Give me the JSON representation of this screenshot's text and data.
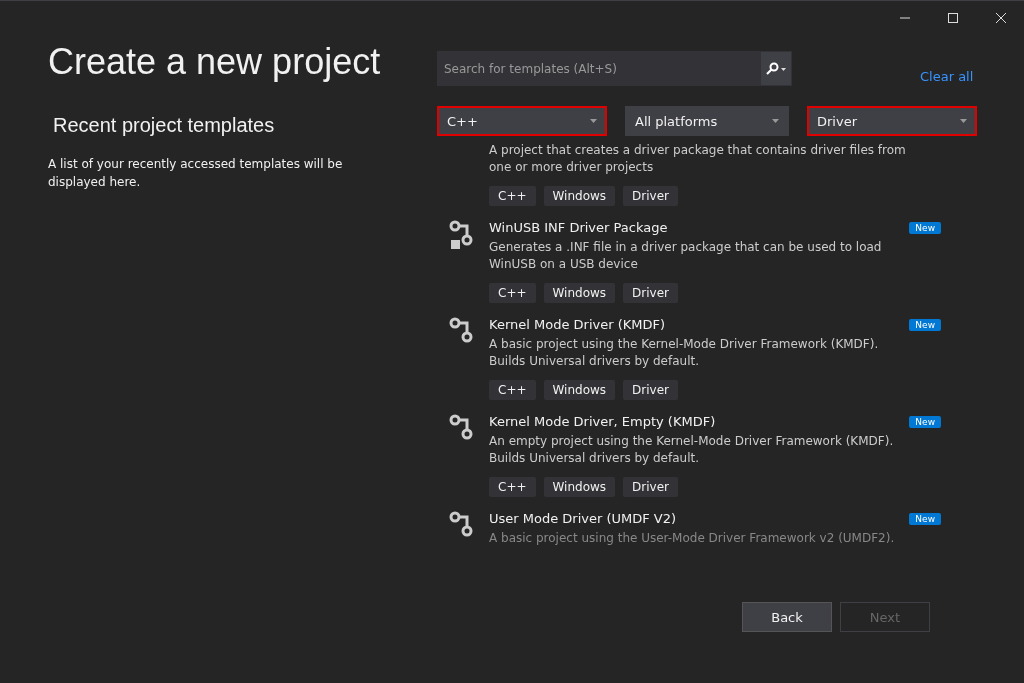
{
  "title": "Create a new project",
  "recent": {
    "heading": "Recent project templates",
    "message": "A list of your recently accessed templates will be displayed here."
  },
  "search": {
    "placeholder": "Search for templates (Alt+S)"
  },
  "clear_all": "Clear all",
  "filters": [
    {
      "value": "C++",
      "highlighted": true
    },
    {
      "value": "All platforms",
      "highlighted": false
    },
    {
      "value": "Driver",
      "highlighted": true
    }
  ],
  "templates": [
    {
      "kind": "partial",
      "description": "A project that creates a driver package that contains driver files from one or more driver projects",
      "tags": [
        "C++",
        "Windows",
        "Driver"
      ],
      "dimmed": false
    },
    {
      "kind": "package",
      "title": "WinUSB INF Driver Package",
      "description": "Generates a .INF file in a driver package that can be used to load WinUSB on a USB device",
      "tags": [
        "C++",
        "Windows",
        "Driver"
      ],
      "badge": "New",
      "dimmed": false
    },
    {
      "kind": "driver",
      "title": "Kernel Mode Driver (KMDF)",
      "description": "A basic project using the Kernel-Mode Driver Framework (KMDF). Builds Universal drivers by default.",
      "tags": [
        "C++",
        "Windows",
        "Driver"
      ],
      "badge": "New",
      "dimmed": false
    },
    {
      "kind": "driver",
      "title": "Kernel Mode Driver, Empty (KMDF)",
      "description": "An empty project using the Kernel-Mode Driver Framework (KMDF). Builds Universal drivers by default.",
      "tags": [
        "C++",
        "Windows",
        "Driver"
      ],
      "badge": "New",
      "dimmed": false
    },
    {
      "kind": "driver",
      "title": "User Mode Driver (UMDF V2)",
      "description": "A basic project using the User-Mode Driver Framework v2 (UMDF2).",
      "badge": "New",
      "dimmed": true
    }
  ],
  "buttons": [
    {
      "label": "Back",
      "disabled": false
    },
    {
      "label": "Next",
      "disabled": true
    }
  ]
}
